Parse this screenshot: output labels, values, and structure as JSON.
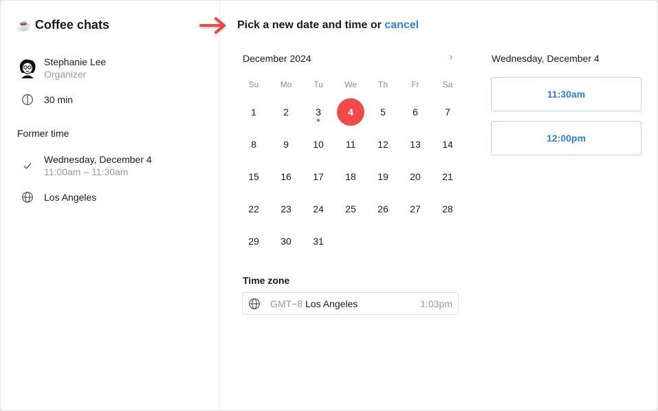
{
  "sidebar": {
    "cup": "☕",
    "title": "Coffee chats",
    "organizer_name": "Stephanie Lee",
    "organizer_role": "Organizer",
    "duration": "30 min",
    "former_time_label": "Former time",
    "former_date": "Wednesday, December 4",
    "former_range": "11:00am – 11:30am",
    "location": "Los Angeles"
  },
  "header": {
    "prompt": "Pick a new date and time or",
    "cancel": "cancel"
  },
  "calendar": {
    "month": "December 2024",
    "next": "›",
    "weekdays": [
      "Su",
      "Mo",
      "Tu",
      "We",
      "Th",
      "Fr",
      "Sa"
    ],
    "weeks": [
      [
        "1",
        "2",
        "3",
        "4",
        "5",
        "6",
        "7"
      ],
      [
        "8",
        "9",
        "10",
        "11",
        "12",
        "13",
        "14"
      ],
      [
        "15",
        "16",
        "17",
        "18",
        "19",
        "20",
        "21"
      ],
      [
        "22",
        "23",
        "24",
        "25",
        "26",
        "27",
        "28"
      ],
      [
        "29",
        "30",
        "31",
        "",
        "",
        "",
        ""
      ]
    ],
    "selected_day": "4",
    "today_day": "3"
  },
  "timezone": {
    "label": "Time zone",
    "offset": "GMT−8",
    "city": "Los Angeles",
    "current_time": "1:03pm"
  },
  "slots": {
    "date": "Wednesday, December 4",
    "times": [
      "11:30am",
      "12:00pm"
    ]
  },
  "colors": {
    "accent": "#ef4a4a",
    "link": "#2f7fd6",
    "slot_border": "#b8d3f1"
  }
}
